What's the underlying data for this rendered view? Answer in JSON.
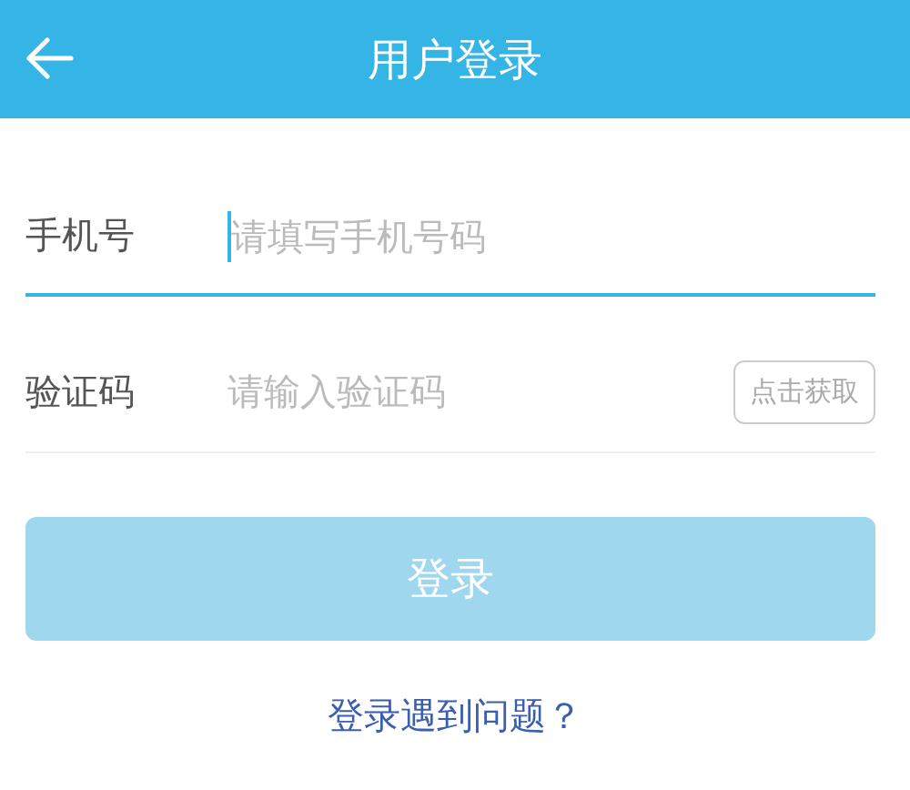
{
  "header": {
    "title": "用户登录"
  },
  "fields": [
    {
      "label": "手机号",
      "placeholder": "请填写手机号码",
      "focused": true
    },
    {
      "label": "验证码",
      "placeholder": "请输入验证码",
      "focused": false,
      "action": "点击获取"
    }
  ],
  "login_button": {
    "label": "登录",
    "disabled": true
  },
  "help_link": "登录遇到问题？"
}
